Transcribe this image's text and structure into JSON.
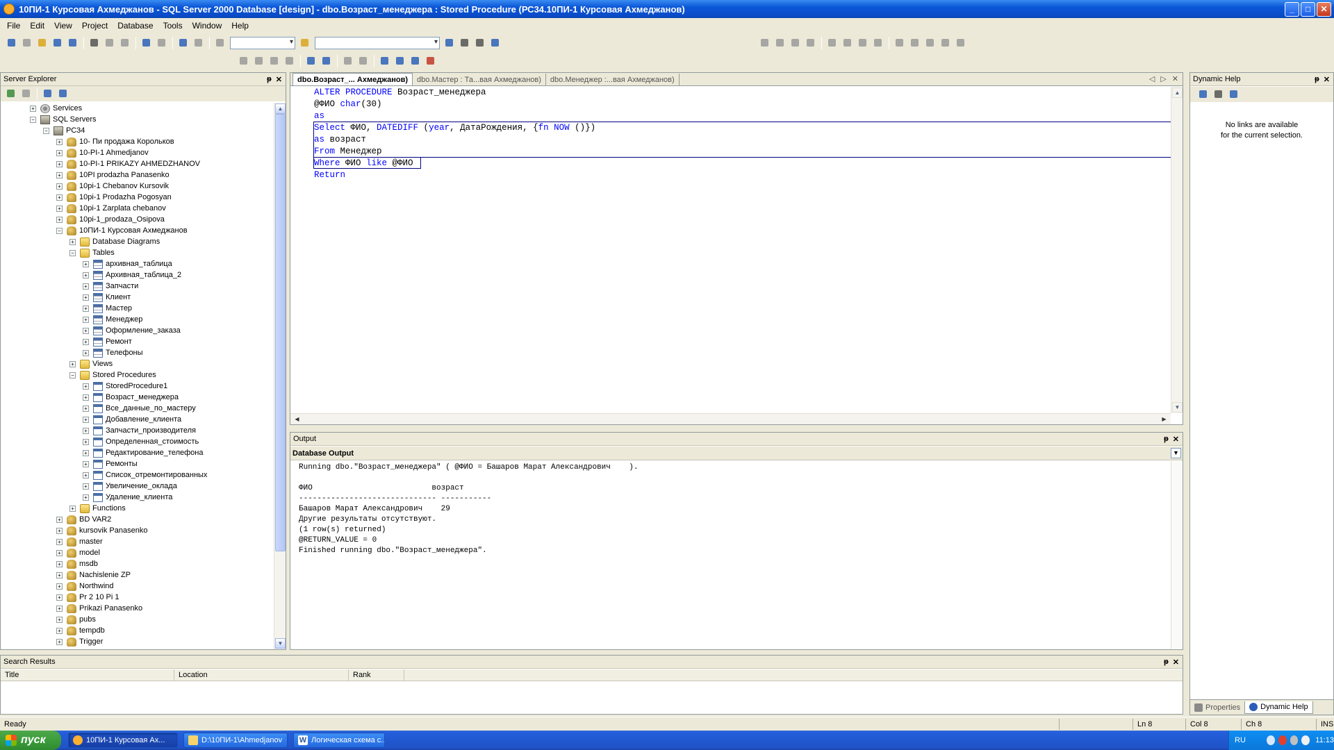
{
  "window": {
    "title": "10ПИ-1 Курсовая Ахмеджанов - SQL Server 2000 Database [design] - dbo.Возраст_менеджера : Stored Procedure (РС34.10ПИ-1 Курсовая Ахмеджанов)",
    "buttons": {
      "minimize": "_",
      "maximize": "□",
      "close": "✕"
    }
  },
  "menu": [
    "File",
    "Edit",
    "View",
    "Project",
    "Database",
    "Tools",
    "Window",
    "Help"
  ],
  "server_explorer": {
    "title": "Server Explorer",
    "pin": "ᵽ",
    "close": "✕",
    "tree": [
      {
        "label": "Services",
        "level": 2,
        "exp": "+",
        "icon": "services"
      },
      {
        "label": "SQL Servers",
        "level": 2,
        "exp": "−",
        "icon": "server"
      },
      {
        "label": "РС34",
        "level": 3,
        "exp": "−",
        "icon": "server"
      },
      {
        "label": "10- Пи продажа Корольков",
        "level": 4,
        "exp": "+",
        "icon": "db"
      },
      {
        "label": "10-PI-1 Ahmedjanov",
        "level": 4,
        "exp": "+",
        "icon": "db"
      },
      {
        "label": "10-PI-1 PRIKAZY AHMEDZHANOV",
        "level": 4,
        "exp": "+",
        "icon": "db"
      },
      {
        "label": "10PI prodazha Panasenko",
        "level": 4,
        "exp": "+",
        "icon": "db"
      },
      {
        "label": "10pi-1 Chebanov Kursovik",
        "level": 4,
        "exp": "+",
        "icon": "db"
      },
      {
        "label": "10pi-1 Prodazha Pogosyan",
        "level": 4,
        "exp": "+",
        "icon": "db"
      },
      {
        "label": "10pi-1 Zarplata chebanov",
        "level": 4,
        "exp": "+",
        "icon": "db"
      },
      {
        "label": "10pi-1_prodaza_Osipova",
        "level": 4,
        "exp": "+",
        "icon": "db"
      },
      {
        "label": "10ПИ-1 Курсовая Ахмеджанов",
        "level": 4,
        "exp": "−",
        "icon": "db"
      },
      {
        "label": "Database Diagrams",
        "level": 5,
        "exp": "+",
        "icon": "folder"
      },
      {
        "label": "Tables",
        "level": 5,
        "exp": "−",
        "icon": "folder"
      },
      {
        "label": "архивная_таблица",
        "level": 6,
        "exp": "+",
        "icon": "table"
      },
      {
        "label": "Архивная_таблица_2",
        "level": 6,
        "exp": "+",
        "icon": "table"
      },
      {
        "label": "Запчасти",
        "level": 6,
        "exp": "+",
        "icon": "table"
      },
      {
        "label": "Клиент",
        "level": 6,
        "exp": "+",
        "icon": "table"
      },
      {
        "label": "Мастер",
        "level": 6,
        "exp": "+",
        "icon": "table"
      },
      {
        "label": "Менеджер",
        "level": 6,
        "exp": "+",
        "icon": "table"
      },
      {
        "label": "Оформление_заказа",
        "level": 6,
        "exp": "+",
        "icon": "table"
      },
      {
        "label": "Ремонт",
        "level": 6,
        "exp": "+",
        "icon": "table"
      },
      {
        "label": "Телефоны",
        "level": 6,
        "exp": "+",
        "icon": "table"
      },
      {
        "label": "Views",
        "level": 5,
        "exp": "+",
        "icon": "folder"
      },
      {
        "label": "Stored Procedures",
        "level": 5,
        "exp": "−",
        "icon": "folder"
      },
      {
        "label": "StoredProcedure1",
        "level": 6,
        "exp": "+",
        "icon": "sp"
      },
      {
        "label": "Возраст_менеджера",
        "level": 6,
        "exp": "+",
        "icon": "sp"
      },
      {
        "label": "Все_данные_по_мастеру",
        "level": 6,
        "exp": "+",
        "icon": "sp"
      },
      {
        "label": "Добавление_клиента",
        "level": 6,
        "exp": "+",
        "icon": "sp"
      },
      {
        "label": "Запчасти_производителя",
        "level": 6,
        "exp": "+",
        "icon": "sp"
      },
      {
        "label": "Определенная_стоимость",
        "level": 6,
        "exp": "+",
        "icon": "sp"
      },
      {
        "label": "Редактирование_телефона",
        "level": 6,
        "exp": "+",
        "icon": "sp"
      },
      {
        "label": "Ремонты",
        "level": 6,
        "exp": "+",
        "icon": "sp"
      },
      {
        "label": "Список_отремонтированных",
        "level": 6,
        "exp": "+",
        "icon": "sp"
      },
      {
        "label": "Увеличение_оклада",
        "level": 6,
        "exp": "+",
        "icon": "sp"
      },
      {
        "label": "Удаление_клиента",
        "level": 6,
        "exp": "+",
        "icon": "sp"
      },
      {
        "label": "Functions",
        "level": 5,
        "exp": "+",
        "icon": "folder"
      },
      {
        "label": "BD VAR2",
        "level": 4,
        "exp": "+",
        "icon": "db"
      },
      {
        "label": "kursovik Panasenko",
        "level": 4,
        "exp": "+",
        "icon": "db"
      },
      {
        "label": "master",
        "level": 4,
        "exp": "+",
        "icon": "db"
      },
      {
        "label": "model",
        "level": 4,
        "exp": "+",
        "icon": "db"
      },
      {
        "label": "msdb",
        "level": 4,
        "exp": "+",
        "icon": "db"
      },
      {
        "label": "Nachislenie ZP",
        "level": 4,
        "exp": "+",
        "icon": "db"
      },
      {
        "label": "Northwind",
        "level": 4,
        "exp": "+",
        "icon": "db"
      },
      {
        "label": "Pr 2 10 Pi 1",
        "level": 4,
        "exp": "+",
        "icon": "db"
      },
      {
        "label": "Prikazi Panasenko",
        "level": 4,
        "exp": "+",
        "icon": "db"
      },
      {
        "label": "pubs",
        "level": 4,
        "exp": "+",
        "icon": "db"
      },
      {
        "label": "tempdb",
        "level": 4,
        "exp": "+",
        "icon": "db"
      },
      {
        "label": "Trigger",
        "level": 4,
        "exp": "+",
        "icon": "db"
      }
    ]
  },
  "editor": {
    "tabs": [
      {
        "label": "dbo.Возраст_... Ахмеджанов)",
        "active": true
      },
      {
        "label": "dbo.Мастер : Та...вая Ахмеджанов)",
        "active": false
      },
      {
        "label": "dbo.Менеджер :...вая Ахмеджанов)",
        "active": false
      }
    ],
    "nav": {
      "prev": "◁",
      "next": "▷",
      "close": "✕"
    },
    "code": [
      [
        {
          "t": "ALTER PROCEDURE",
          "k": true
        },
        {
          "t": " Возраст_менеджера",
          "k": false
        }
      ],
      [
        {
          "t": "@ФИО ",
          "k": false
        },
        {
          "t": "char",
          "k": true
        },
        {
          "t": "(30)",
          "k": false
        }
      ],
      [
        {
          "t": "as",
          "k": true
        }
      ],
      [
        {
          "t": "Select",
          "k": true
        },
        {
          "t": " ФИО, ",
          "k": false
        },
        {
          "t": "DATEDIFF",
          "k": true
        },
        {
          "t": " (",
          "k": false
        },
        {
          "t": "year",
          "k": true
        },
        {
          "t": ", ДатаРождения, {",
          "k": false
        },
        {
          "t": "fn NOW",
          "k": true
        },
        {
          "t": " ()})",
          "k": false
        }
      ],
      [
        {
          "t": "as",
          "k": true
        },
        {
          "t": " возраст",
          "k": false
        }
      ],
      [
        {
          "t": "From",
          "k": true
        },
        {
          "t": " Менеджер",
          "k": false
        }
      ],
      [
        {
          "t": "Where",
          "k": true
        },
        {
          "t": " ФИО ",
          "k": false
        },
        {
          "t": "like",
          "k": true
        },
        {
          "t": " @ФИО",
          "k": false
        }
      ],
      [
        {
          "t": "Return",
          "k": true
        }
      ]
    ]
  },
  "output": {
    "title": "Output",
    "pane": "Database Output",
    "lines": [
      "Running dbo.\"Возраст_менеджера\" ( @ФИО = Башаров Марат Александрович    ).",
      "",
      "ФИО                          возраст",
      "------------------------------ -----------",
      "Башаров Марат Александрович    29",
      "Другие результаты отсутствуют.",
      "(1 row(s) returned)",
      "@RETURN_VALUE = 0",
      "Finished running dbo.\"Возраст_менеджера\"."
    ]
  },
  "dynamic_help": {
    "title": "Dynamic Help",
    "message_line1": "No links are available",
    "message_line2": "for the current selection.",
    "tab_properties": "Properties",
    "tab_dynamic_help": "Dynamic Help"
  },
  "search_results": {
    "title": "Search Results",
    "columns": [
      "Title",
      "Location",
      "Rank"
    ]
  },
  "status": {
    "text": "Ready",
    "ln": "Ln 8",
    "col": "Col 8",
    "ch": "Ch 8",
    "mode": "INS"
  },
  "taskbar": {
    "start": "пуск",
    "tasks": [
      {
        "label": "10ПИ-1 Курсовая Ах...",
        "active": true
      },
      {
        "label": "D:\\10ПИ-1\\Ahmedjanov",
        "active": false
      },
      {
        "label": "Логическая схема с...",
        "active": false
      }
    ],
    "lang": "RU",
    "clock": "11:13"
  }
}
